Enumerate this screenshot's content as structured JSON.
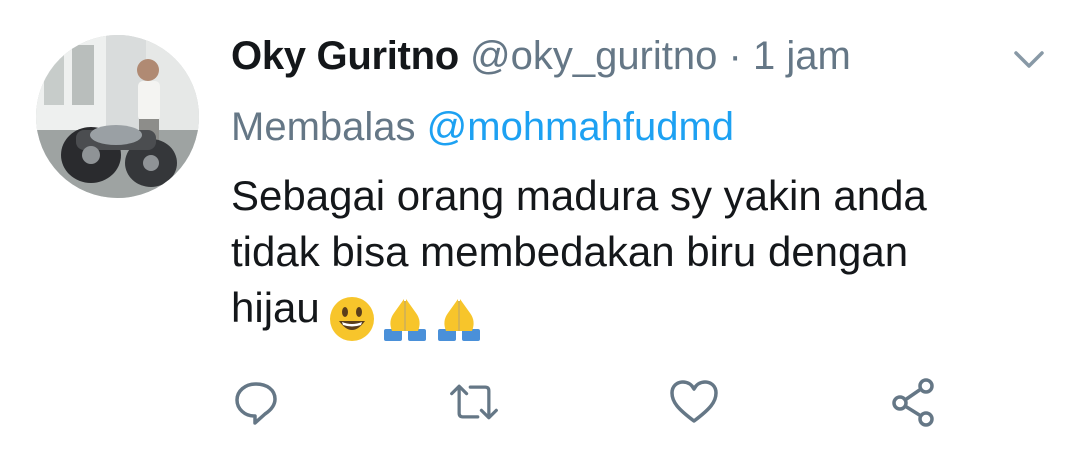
{
  "tweet": {
    "display_name": "Oky Guritno",
    "handle": "@oky_guritno",
    "separator": "·",
    "time": "1 jam",
    "reply_prefix": "Membalas",
    "reply_to": "@mohmahfudmd",
    "text_lines": [
      "Sebagai orang madura sy yakin anda",
      "tidak bisa membedakan biru dengan",
      "hijau"
    ],
    "emojis": [
      "grinning-face-emoji",
      "folded-hands-emoji",
      "folded-hands-emoji"
    ]
  },
  "actions": {
    "icons": [
      "reply-icon",
      "retweet-icon",
      "like-icon",
      "share-icon"
    ]
  },
  "colors": {
    "name": "#14171a",
    "secondary": "#657786",
    "mention": "#1da1f2",
    "icon": "#657786"
  }
}
